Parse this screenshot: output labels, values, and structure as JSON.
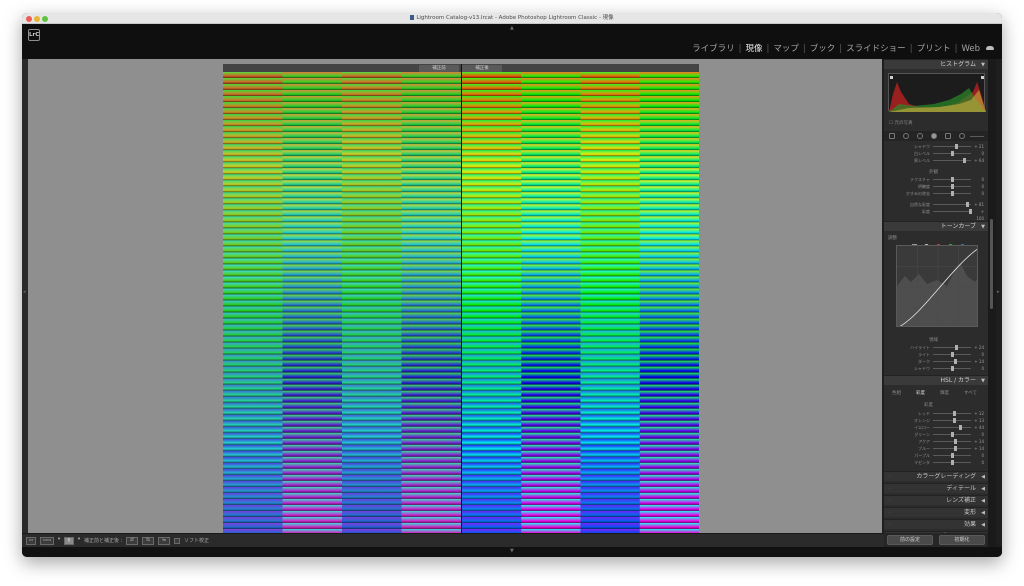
{
  "window": {
    "title": "Lightroom Catalog-v13.lrcat - Adobe Photoshop Lightroom Classic - 現像"
  },
  "app": {
    "logo_text": "LrC",
    "modules": [
      {
        "label": "ライブラリ",
        "active": false
      },
      {
        "label": "現像",
        "active": true
      },
      {
        "label": "マップ",
        "active": false
      },
      {
        "label": "ブック",
        "active": false
      },
      {
        "label": "スライドショー",
        "active": false
      },
      {
        "label": "プリント",
        "active": false
      },
      {
        "label": "Web",
        "active": false
      }
    ]
  },
  "viewer": {
    "before_label": "補正前",
    "after_label": "補正後"
  },
  "right_panel": {
    "histogram_title": "ヒストグラム",
    "original_photo_label": "元の写真",
    "basic_sliders_top": [
      {
        "label": "シャドウ",
        "value": "+ 21"
      },
      {
        "label": "白レベル",
        "value": "0"
      },
      {
        "label": "黒レベル",
        "value": "+ 64"
      }
    ],
    "presence_title": "外観",
    "presence_sliders": [
      {
        "label": "テクスチャ",
        "value": "0"
      },
      {
        "label": "明瞭度",
        "value": "0"
      },
      {
        "label": "かすみの除去",
        "value": "0"
      }
    ],
    "vibrance_sliders": [
      {
        "label": "自然な彩度",
        "value": "+ 81"
      },
      {
        "label": "彩度",
        "value": "+ 100"
      }
    ],
    "tone_curve_title": "トーンカーブ",
    "tone_curve_channel_label": "調整",
    "region_title": "領域",
    "region_sliders": [
      {
        "label": "ハイライト",
        "value": "+ 24"
      },
      {
        "label": "ライト",
        "value": "0"
      },
      {
        "label": "ダーク",
        "value": "+ 14"
      },
      {
        "label": "シャドウ",
        "value": "0"
      }
    ],
    "hsl_title": "HSL / カラー",
    "hsl_tabs": [
      "色相",
      "彩度",
      "輝度",
      "すべて"
    ],
    "hsl_group_title": "彩度",
    "hsl_sliders": [
      {
        "label": "レッド",
        "value": "+ 12"
      },
      {
        "label": "オレンジ",
        "value": "+ 13"
      },
      {
        "label": "イエロー",
        "value": "+ 44"
      },
      {
        "label": "グリーン",
        "value": "0"
      },
      {
        "label": "アクア",
        "value": "+ 14"
      },
      {
        "label": "ブルー",
        "value": "+ 14"
      },
      {
        "label": "パープル",
        "value": "0"
      },
      {
        "label": "マゼンタ",
        "value": "0"
      }
    ],
    "collapsed_panels": [
      "カラーグレーディング",
      "ディテール",
      "レンズ補正",
      "変形",
      "効果",
      "キャリブレーション"
    ],
    "previous_button": "前の設定",
    "reset_button": "初期化"
  },
  "toolbar": {
    "view_mode_label": "補正前と補正後 :",
    "soft_proof_label": "ソフト校正"
  },
  "colors": {
    "panel_bg": "#2c2c2c",
    "center_bg": "#8f8f8f",
    "header_bg": "#3a3a3a"
  }
}
